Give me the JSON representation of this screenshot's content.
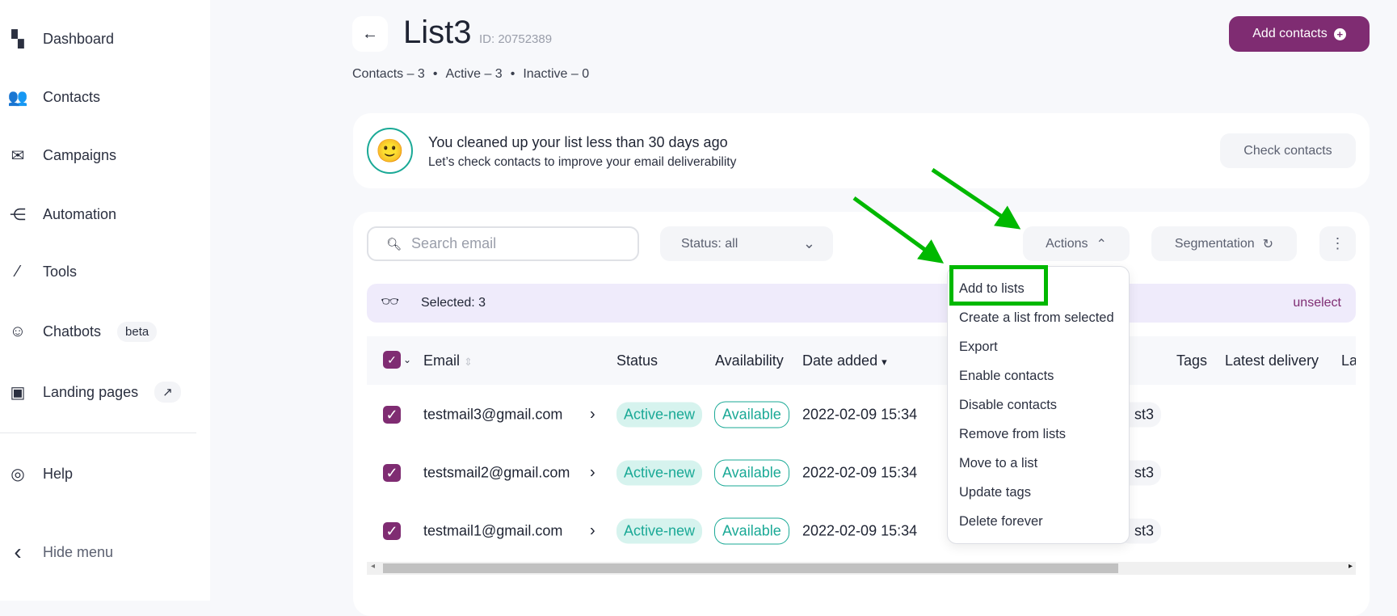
{
  "sidebar": {
    "items": [
      {
        "label": "Dashboard",
        "icon": "grid-icon"
      },
      {
        "label": "Contacts",
        "icon": "users-icon"
      },
      {
        "label": "Campaigns",
        "icon": "mail-stack-icon"
      },
      {
        "label": "Automation",
        "icon": "share-nodes-icon"
      },
      {
        "label": "Tools",
        "icon": "magic-wand-icon"
      },
      {
        "label": "Chatbots",
        "icon": "robot-icon",
        "badge": "beta"
      },
      {
        "label": "Landing pages",
        "icon": "landing-icon",
        "external_icon": "external-link-icon"
      }
    ],
    "help": "Help",
    "hide_menu": "Hide menu"
  },
  "header": {
    "title": "List3",
    "id": "ID: 20752389",
    "stats": [
      "Contacts – 3",
      "Active – 3",
      "Inactive – 0"
    ],
    "add_contacts": "Add contacts"
  },
  "banner": {
    "title": "You cleaned up your list less than 30 days ago",
    "subtitle": "Let’s check contacts to improve your email deliverability",
    "button": "Check contacts"
  },
  "toolbar": {
    "search_placeholder": "Search email",
    "status": "Status: all",
    "actions": "Actions",
    "segmentation": "Segmentation"
  },
  "selection": {
    "text": "Selected: 3",
    "unselect": "unselect"
  },
  "table": {
    "columns": [
      "Email",
      "Status",
      "Availability",
      "Date added",
      "Tags",
      "Latest delivery",
      "La"
    ],
    "rows": [
      {
        "email": "testmail3@gmail.com",
        "status": "Active-new",
        "availability": "Available",
        "date": "2022-02-09 15:34",
        "list": "st3"
      },
      {
        "email": "testsmail2@gmail.com",
        "status": "Active-new",
        "availability": "Available",
        "date": "2022-02-09 15:34",
        "list": "st3"
      },
      {
        "email": "testmail1@gmail.com",
        "status": "Active-new",
        "availability": "Available",
        "date": "2022-02-09 15:34",
        "list": "st3"
      }
    ]
  },
  "actions_menu": [
    "Add to lists",
    "Create a list from selected",
    "Export",
    "Enable contacts",
    "Disable contacts",
    "Remove from lists",
    "Move to a list",
    "Update tags",
    "Delete forever"
  ],
  "colors": {
    "brand": "#7f2c72",
    "teal": "#1aa996",
    "annotation": "#00b800",
    "selection_bg": "#efebfb"
  }
}
